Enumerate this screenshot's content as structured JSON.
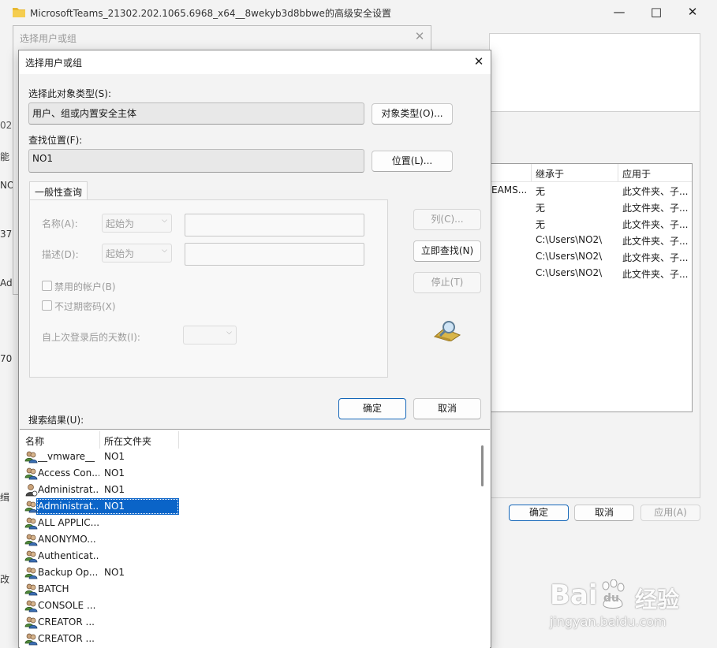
{
  "bg_window": {
    "title": "MicrosoftTeams_21302.202.1065.6968_x64__8wekyb3d8bbwe的高级安全设置",
    "table_headers": [
      "继承于",
      "应用于"
    ],
    "table_rows": [
      {
        "principal": "EAMS...",
        "inherit": "无",
        "applies": "此文件夹、子..."
      },
      {
        "principal": "",
        "inherit": "无",
        "applies": "此文件夹、子..."
      },
      {
        "principal": "",
        "inherit": "无",
        "applies": "此文件夹、子..."
      },
      {
        "principal": "",
        "inherit": "C:\\Users\\NO2\\",
        "applies": "此文件夹、子..."
      },
      {
        "principal": "",
        "inherit": "C:\\Users\\NO2\\",
        "applies": "此文件夹、子..."
      },
      {
        "principal": "",
        "inherit": "C:\\Users\\NO2\\",
        "applies": "此文件夹、子..."
      }
    ],
    "ok_label": "确定",
    "cancel_label": "取消",
    "apply_label": "应用(A)",
    "left_fragments": [
      "02",
      "能",
      "NO",
      "37",
      "Ad",
      "70",
      "缉",
      "改"
    ]
  },
  "mid_dialog": {
    "title": "选择用户或组"
  },
  "dialog": {
    "title": "选择用户或组",
    "object_type_label": "选择此对象类型(S):",
    "object_type_value": "用户、组或内置安全主体",
    "object_type_button": "对象类型(O)...",
    "location_label": "查找位置(F):",
    "location_value": "NO1",
    "location_button": "位置(L)...",
    "tab_label": "一般性查询",
    "name_label": "名称(A):",
    "name_combo": "起始为",
    "desc_label": "描述(D):",
    "desc_combo": "起始为",
    "disabled_accounts": "禁用的帐户(B)",
    "no_expire": "不过期密码(X)",
    "days_label": "自上次登录后的天数(I):",
    "columns_button": "列(C)...",
    "find_now_button": "立即查找(N)",
    "stop_button": "停止(T)",
    "ok_button": "确定",
    "cancel_button": "取消",
    "results_label": "搜索结果(U):",
    "results_headers": [
      "名称",
      "所在文件夹"
    ],
    "results": [
      {
        "name": "__vmware__",
        "folder": "NO1",
        "selected": false,
        "icon": "group-icon"
      },
      {
        "name": "Access Con...",
        "folder": "NO1",
        "selected": false,
        "icon": "group-icon"
      },
      {
        "name": "Administrat...",
        "folder": "NO1",
        "selected": false,
        "icon": "user-icon"
      },
      {
        "name": "Administrat...",
        "folder": "NO1",
        "selected": true,
        "icon": "group-icon"
      },
      {
        "name": "ALL APPLIC...",
        "folder": "",
        "selected": false,
        "icon": "group-icon"
      },
      {
        "name": "ANONYMO...",
        "folder": "",
        "selected": false,
        "icon": "group-icon"
      },
      {
        "name": "Authenticat...",
        "folder": "",
        "selected": false,
        "icon": "group-icon"
      },
      {
        "name": "Backup Op...",
        "folder": "NO1",
        "selected": false,
        "icon": "group-icon"
      },
      {
        "name": "BATCH",
        "folder": "",
        "selected": false,
        "icon": "group-icon"
      },
      {
        "name": "CONSOLE ...",
        "folder": "",
        "selected": false,
        "icon": "group-icon"
      },
      {
        "name": "CREATOR ...",
        "folder": "",
        "selected": false,
        "icon": "group-icon"
      },
      {
        "name": "CREATOR ...",
        "folder": "",
        "selected": false,
        "icon": "group-icon"
      }
    ]
  },
  "watermark": {
    "brand": "Bai",
    "brand_paw": "du",
    "brand_cn": "经验",
    "url": "jingyan.baidu.com"
  },
  "colors": {
    "selection": "#0a64c8",
    "primary_border": "#1466b8",
    "folder_icon": "#e8b830"
  }
}
